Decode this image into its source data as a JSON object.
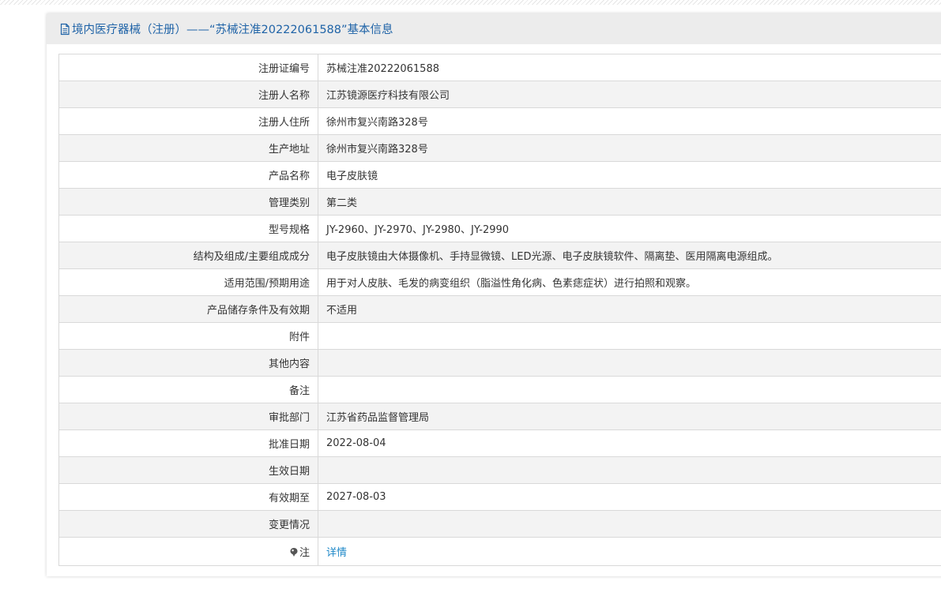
{
  "panel": {
    "title": "境内医疗器械（注册）——“苏械注准20222061588”基本信息",
    "icon": "document-icon",
    "title_color": "#1f63a7"
  },
  "rows": [
    {
      "label": "注册证编号",
      "value": "苏械注准20222061588"
    },
    {
      "label": "注册人名称",
      "value": "江苏镜源医疗科技有限公司"
    },
    {
      "label": "注册人住所",
      "value": "徐州市复兴南路328号"
    },
    {
      "label": "生产地址",
      "value": "徐州市复兴南路328号"
    },
    {
      "label": "产品名称",
      "value": "电子皮肤镜"
    },
    {
      "label": "管理类别",
      "value": "第二类"
    },
    {
      "label": "型号规格",
      "value": "JY-2960、JY-2970、JY-2980、JY-2990"
    },
    {
      "label": "结构及组成/主要组成成分",
      "value": "电子皮肤镜由大体摄像机、手持显微镜、LED光源、电子皮肤镜软件、隔离垫、医用隔离电源组成。"
    },
    {
      "label": "适用范围/预期用途",
      "value": "用于对人皮肤、毛发的病变组织（脂溢性角化病、色素痣症状）进行拍照和观察。"
    },
    {
      "label": "产品储存条件及有效期",
      "value": "不适用"
    },
    {
      "label": "附件",
      "value": ""
    },
    {
      "label": "其他内容",
      "value": ""
    },
    {
      "label": "备注",
      "value": ""
    },
    {
      "label": "审批部门",
      "value": "江苏省药品监督管理局"
    },
    {
      "label": "批准日期",
      "value": "2022-08-04"
    },
    {
      "label": "生效日期",
      "value": ""
    },
    {
      "label": "有效期至",
      "value": "2027-08-03"
    },
    {
      "label": "变更情况",
      "value": ""
    }
  ],
  "note_row": {
    "label": "注",
    "icon": "pin-icon",
    "link_text": "详情",
    "link_color": "#1e88c8"
  }
}
